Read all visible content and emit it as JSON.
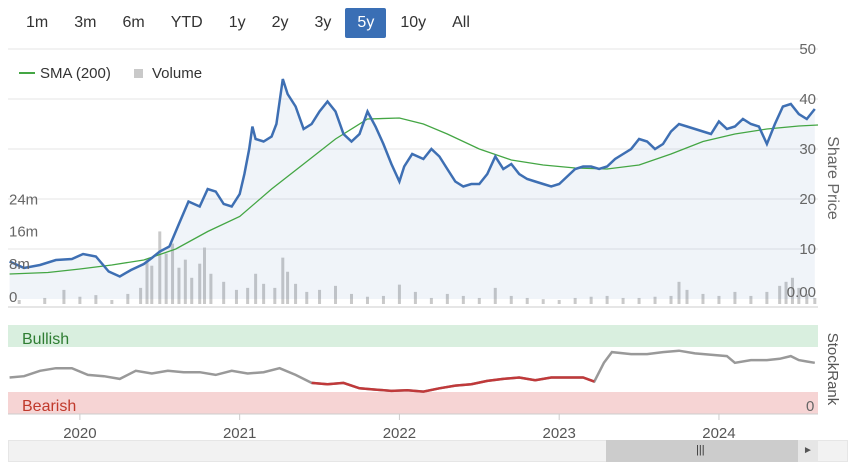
{
  "ranges": [
    "1m",
    "3m",
    "6m",
    "YTD",
    "1y",
    "2y",
    "3y",
    "5y",
    "10y",
    "All"
  ],
  "active_range": "5y",
  "colors": {
    "price": "#3e6fb3",
    "sma": "#44a644",
    "volume": "#c9c9c9",
    "rank": "#999999",
    "bearish_line": "#c0393a",
    "bullish_band": "#d9efdf",
    "bearish_band": "#f6d4d4",
    "accent": "#3a6fb5"
  },
  "chart_data": {
    "type": "line",
    "legend": [
      {
        "name": "SMA (200)",
        "marker": "line"
      },
      {
        "name": "Volume",
        "marker": "square"
      }
    ],
    "legend_placement": "top-left",
    "x_ticks": [
      "2020",
      "2021",
      "2022",
      "2023",
      "2024"
    ],
    "xlim": [
      2019.55,
      2024.62
    ],
    "price_axis": {
      "label": "Share Price",
      "ticks": [
        "50",
        "40",
        "30",
        "20",
        "10",
        "0.00"
      ],
      "ylim": [
        0,
        50
      ]
    },
    "volume_axis": {
      "ticks": [
        "24m",
        "16m",
        "8m",
        "0"
      ],
      "ylim": [
        0,
        32
      ]
    },
    "series": [
      {
        "name": "Price",
        "points": [
          [
            2019.56,
            7.5
          ],
          [
            2019.65,
            6.2
          ],
          [
            2019.75,
            6.8
          ],
          [
            2019.85,
            7.8
          ],
          [
            2019.95,
            8.0
          ],
          [
            2020.02,
            9.0
          ],
          [
            2020.1,
            8.5
          ],
          [
            2020.18,
            5.5
          ],
          [
            2020.25,
            4.5
          ],
          [
            2020.32,
            5.8
          ],
          [
            2020.4,
            7.0
          ],
          [
            2020.45,
            8.2
          ],
          [
            2020.5,
            9.5
          ],
          [
            2020.56,
            10.5
          ],
          [
            2020.62,
            15.0
          ],
          [
            2020.68,
            19.5
          ],
          [
            2020.75,
            18.5
          ],
          [
            2020.8,
            22.0
          ],
          [
            2020.85,
            21.5
          ],
          [
            2020.9,
            19.0
          ],
          [
            2020.95,
            18.5
          ],
          [
            2021.0,
            21.0
          ],
          [
            2021.03,
            25.0
          ],
          [
            2021.06,
            30.0
          ],
          [
            2021.08,
            34.5
          ],
          [
            2021.1,
            32.0
          ],
          [
            2021.15,
            31.5
          ],
          [
            2021.2,
            32.5
          ],
          [
            2021.23,
            35.0
          ],
          [
            2021.27,
            44.0
          ],
          [
            2021.3,
            41.0
          ],
          [
            2021.35,
            38.5
          ],
          [
            2021.4,
            34.0
          ],
          [
            2021.45,
            35.0
          ],
          [
            2021.5,
            37.5
          ],
          [
            2021.55,
            39.5
          ],
          [
            2021.6,
            37.5
          ],
          [
            2021.65,
            33.0
          ],
          [
            2021.7,
            31.5
          ],
          [
            2021.75,
            33.0
          ],
          [
            2021.8,
            37.5
          ],
          [
            2021.85,
            34.5
          ],
          [
            2021.9,
            31.0
          ],
          [
            2021.95,
            27.0
          ],
          [
            2022.0,
            23.5
          ],
          [
            2022.03,
            26.5
          ],
          [
            2022.08,
            29.0
          ],
          [
            2022.15,
            28.0
          ],
          [
            2022.2,
            30.0
          ],
          [
            2022.25,
            28.5
          ],
          [
            2022.3,
            26.0
          ],
          [
            2022.35,
            23.5
          ],
          [
            2022.4,
            22.5
          ],
          [
            2022.45,
            23.0
          ],
          [
            2022.5,
            23.0
          ],
          [
            2022.55,
            25.0
          ],
          [
            2022.6,
            28.5
          ],
          [
            2022.65,
            26.0
          ],
          [
            2022.7,
            27.0
          ],
          [
            2022.75,
            25.0
          ],
          [
            2022.8,
            24.0
          ],
          [
            2022.85,
            23.5
          ],
          [
            2022.9,
            23.0
          ],
          [
            2022.95,
            22.5
          ],
          [
            2023.0,
            23.0
          ],
          [
            2023.05,
            24.5
          ],
          [
            2023.1,
            26.0
          ],
          [
            2023.15,
            26.5
          ],
          [
            2023.2,
            26.5
          ],
          [
            2023.25,
            26.0
          ],
          [
            2023.3,
            26.5
          ],
          [
            2023.35,
            28.0
          ],
          [
            2023.4,
            29.0
          ],
          [
            2023.45,
            30.0
          ],
          [
            2023.5,
            32.0
          ],
          [
            2023.55,
            31.5
          ],
          [
            2023.6,
            30.0
          ],
          [
            2023.65,
            31.0
          ],
          [
            2023.7,
            33.5
          ],
          [
            2023.75,
            35.0
          ],
          [
            2023.8,
            34.5
          ],
          [
            2023.85,
            34.0
          ],
          [
            2023.9,
            33.5
          ],
          [
            2023.95,
            33.0
          ],
          [
            2024.0,
            35.5
          ],
          [
            2024.05,
            34.0
          ],
          [
            2024.1,
            34.5
          ],
          [
            2024.15,
            36.0
          ],
          [
            2024.2,
            35.0
          ],
          [
            2024.25,
            34.5
          ],
          [
            2024.3,
            31.0
          ],
          [
            2024.35,
            35.0
          ],
          [
            2024.4,
            38.5
          ],
          [
            2024.45,
            39.0
          ],
          [
            2024.5,
            37.0
          ],
          [
            2024.55,
            36.0
          ],
          [
            2024.6,
            38.0
          ]
        ]
      },
      {
        "name": "SMA (200)",
        "points": [
          [
            2019.56,
            5.0
          ],
          [
            2019.8,
            5.3
          ],
          [
            2020.0,
            6.0
          ],
          [
            2020.2,
            6.8
          ],
          [
            2020.4,
            7.8
          ],
          [
            2020.6,
            10.0
          ],
          [
            2020.8,
            13.5
          ],
          [
            2021.0,
            16.5
          ],
          [
            2021.2,
            22.0
          ],
          [
            2021.4,
            27.0
          ],
          [
            2021.6,
            32.0
          ],
          [
            2021.8,
            36.0
          ],
          [
            2022.0,
            36.2
          ],
          [
            2022.15,
            35.0
          ],
          [
            2022.3,
            33.0
          ],
          [
            2022.5,
            30.0
          ],
          [
            2022.7,
            27.8
          ],
          [
            2022.9,
            26.8
          ],
          [
            2023.1,
            26.2
          ],
          [
            2023.3,
            26.0
          ],
          [
            2023.5,
            26.8
          ],
          [
            2023.7,
            29.0
          ],
          [
            2023.9,
            31.5
          ],
          [
            2024.1,
            33.0
          ],
          [
            2024.3,
            34.0
          ],
          [
            2024.5,
            34.6
          ],
          [
            2024.62,
            34.8
          ]
        ]
      },
      {
        "name": "Volume",
        "points": [
          [
            2019.62,
            1.0
          ],
          [
            2019.78,
            1.5
          ],
          [
            2019.9,
            3.5
          ],
          [
            2020.0,
            1.8
          ],
          [
            2020.1,
            2.2
          ],
          [
            2020.2,
            1.0
          ],
          [
            2020.3,
            2.5
          ],
          [
            2020.38,
            4.0
          ],
          [
            2020.42,
            11.0
          ],
          [
            2020.45,
            9.5
          ],
          [
            2020.5,
            18.0
          ],
          [
            2020.54,
            12.5
          ],
          [
            2020.58,
            15.0
          ],
          [
            2020.62,
            9.0
          ],
          [
            2020.66,
            11.0
          ],
          [
            2020.7,
            6.5
          ],
          [
            2020.75,
            10.0
          ],
          [
            2020.78,
            14.0
          ],
          [
            2020.82,
            7.5
          ],
          [
            2020.9,
            5.5
          ],
          [
            2020.98,
            3.5
          ],
          [
            2021.05,
            4.0
          ],
          [
            2021.1,
            7.5
          ],
          [
            2021.15,
            5.0
          ],
          [
            2021.22,
            4.0
          ],
          [
            2021.27,
            11.5
          ],
          [
            2021.3,
            8.0
          ],
          [
            2021.35,
            5.0
          ],
          [
            2021.42,
            3.0
          ],
          [
            2021.5,
            3.5
          ],
          [
            2021.6,
            4.5
          ],
          [
            2021.7,
            2.5
          ],
          [
            2021.8,
            1.8
          ],
          [
            2021.9,
            2.0
          ],
          [
            2022.0,
            4.8
          ],
          [
            2022.1,
            3.0
          ],
          [
            2022.2,
            1.5
          ],
          [
            2022.3,
            2.5
          ],
          [
            2022.4,
            2.0
          ],
          [
            2022.5,
            1.5
          ],
          [
            2022.6,
            4.0
          ],
          [
            2022.7,
            2.0
          ],
          [
            2022.8,
            1.5
          ],
          [
            2022.9,
            1.2
          ],
          [
            2023.0,
            1.0
          ],
          [
            2023.1,
            1.5
          ],
          [
            2023.2,
            1.8
          ],
          [
            2023.3,
            2.0
          ],
          [
            2023.4,
            1.5
          ],
          [
            2023.5,
            1.5
          ],
          [
            2023.6,
            1.8
          ],
          [
            2023.7,
            2.0
          ],
          [
            2023.75,
            5.5
          ],
          [
            2023.8,
            3.5
          ],
          [
            2023.9,
            2.5
          ],
          [
            2024.0,
            2.0
          ],
          [
            2024.1,
            3.0
          ],
          [
            2024.2,
            2.0
          ],
          [
            2024.3,
            3.0
          ],
          [
            2024.38,
            4.5
          ],
          [
            2024.42,
            5.5
          ],
          [
            2024.46,
            6.5
          ],
          [
            2024.5,
            4.0
          ],
          [
            2024.55,
            2.5
          ],
          [
            2024.6,
            1.5
          ]
        ]
      },
      {
        "name": "StockRank",
        "points": [
          [
            2019.56,
            38
          ],
          [
            2019.65,
            40
          ],
          [
            2019.75,
            48
          ],
          [
            2019.85,
            52
          ],
          [
            2019.95,
            52
          ],
          [
            2020.05,
            42
          ],
          [
            2020.15,
            40
          ],
          [
            2020.25,
            36
          ],
          [
            2020.35,
            48
          ],
          [
            2020.45,
            44
          ],
          [
            2020.55,
            48
          ],
          [
            2020.65,
            46
          ],
          [
            2020.75,
            46
          ],
          [
            2020.85,
            42
          ],
          [
            2020.95,
            48
          ],
          [
            2021.05,
            44
          ],
          [
            2021.15,
            46
          ],
          [
            2021.25,
            52
          ],
          [
            2021.35,
            42
          ],
          [
            2021.45,
            30
          ],
          [
            2021.55,
            28
          ],
          [
            2021.65,
            30
          ],
          [
            2021.75,
            22
          ],
          [
            2021.85,
            20
          ],
          [
            2021.95,
            18
          ],
          [
            2022.05,
            19
          ],
          [
            2022.15,
            17
          ],
          [
            2022.25,
            22
          ],
          [
            2022.35,
            26
          ],
          [
            2022.45,
            28
          ],
          [
            2022.55,
            33
          ],
          [
            2022.65,
            36
          ],
          [
            2022.75,
            38
          ],
          [
            2022.85,
            34
          ],
          [
            2022.95,
            38
          ],
          [
            2023.05,
            38
          ],
          [
            2023.15,
            38
          ],
          [
            2023.22,
            32
          ],
          [
            2023.28,
            60
          ],
          [
            2023.33,
            76
          ],
          [
            2023.45,
            73
          ],
          [
            2023.55,
            73
          ],
          [
            2023.65,
            76
          ],
          [
            2023.75,
            78
          ],
          [
            2023.85,
            74
          ],
          [
            2023.95,
            72
          ],
          [
            2024.05,
            70
          ],
          [
            2024.1,
            60
          ],
          [
            2024.2,
            64
          ],
          [
            2024.3,
            64
          ],
          [
            2024.38,
            66
          ],
          [
            2024.45,
            70
          ],
          [
            2024.5,
            64
          ],
          [
            2024.55,
            62
          ],
          [
            2024.6,
            60
          ]
        ]
      }
    ],
    "rank_panel": {
      "title": "StockRank",
      "bands": [
        "Bullish",
        "Bearish"
      ],
      "ticks": [
        "0"
      ],
      "ylim": [
        0,
        100
      ],
      "bearish_until": 2023.25
    }
  }
}
